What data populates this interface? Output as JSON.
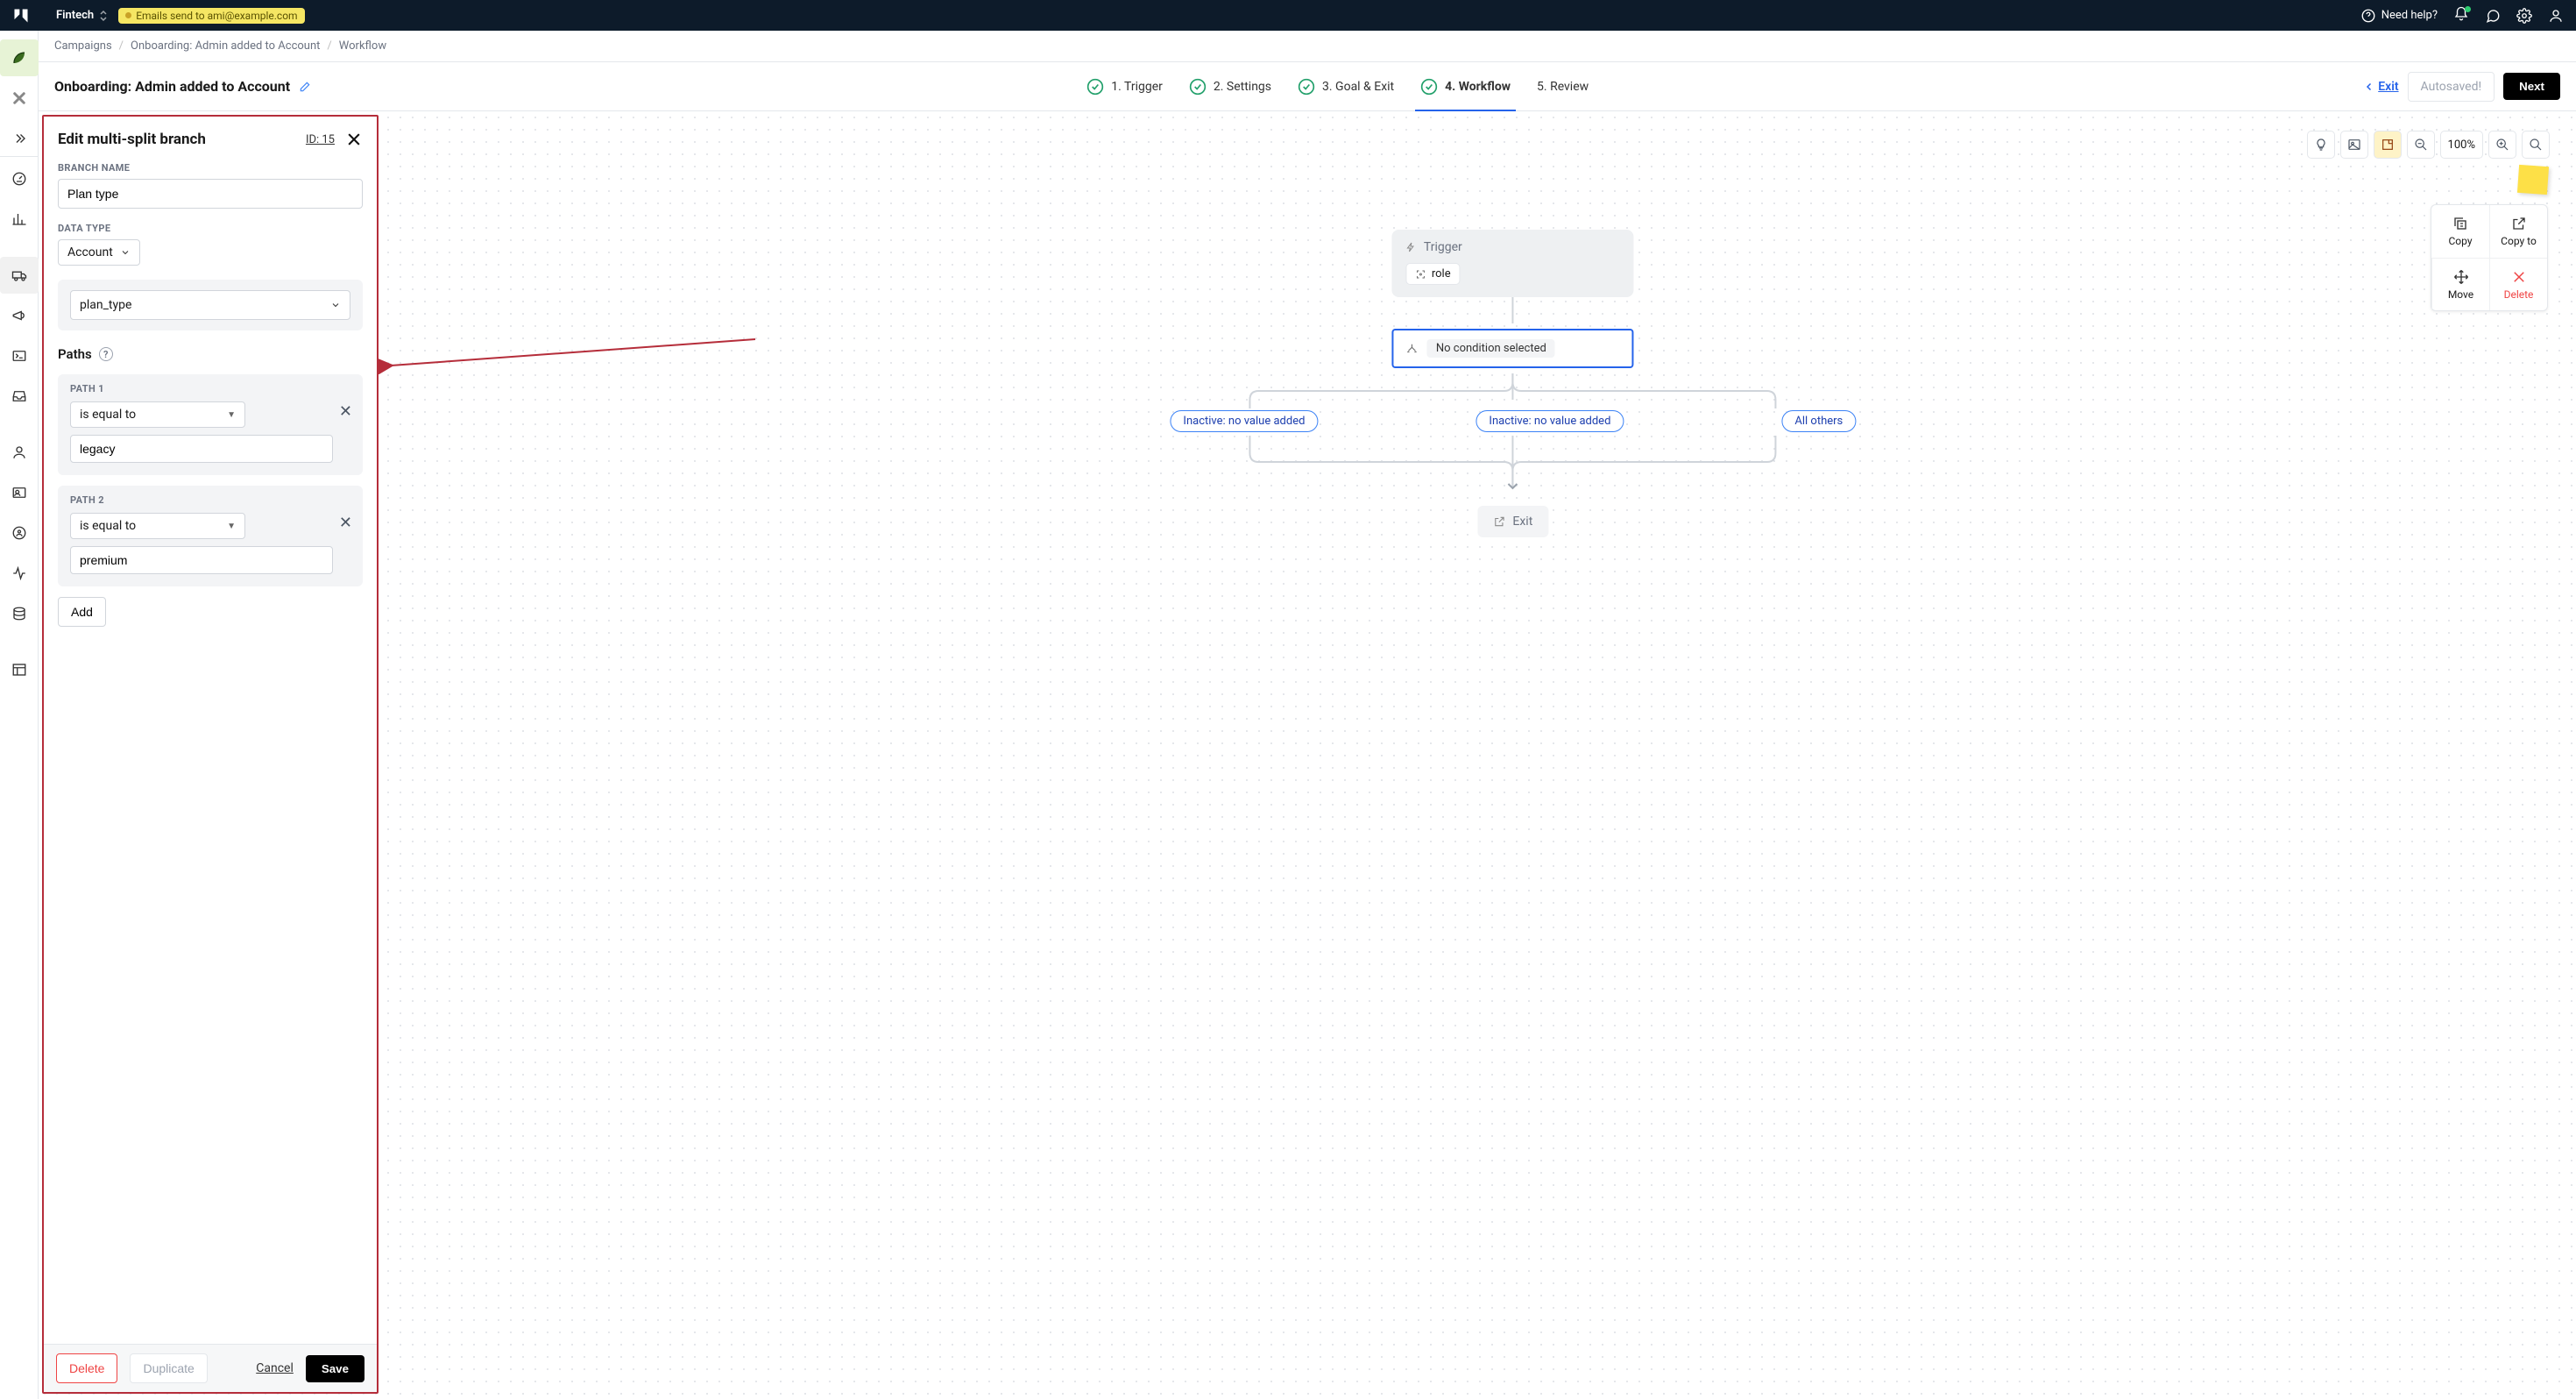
{
  "topbar": {
    "workspace": "Fintech",
    "tag": "Emails send to ami@example.com",
    "need_help": "Need help?"
  },
  "breadcrumbs": {
    "c1": "Campaigns",
    "c2": "Onboarding: Admin added to Account",
    "c3": "Workflow"
  },
  "header": {
    "title": "Onboarding: Admin added to Account",
    "exit": "Exit",
    "autosaved": "Autosaved!",
    "next": "Next"
  },
  "steps": {
    "s1": "1. Trigger",
    "s2": "2. Settings",
    "s3": "3. Goal & Exit",
    "s4": "4. Workflow",
    "s5": "5. Review"
  },
  "panel": {
    "title": "Edit multi-split branch",
    "id": "ID: 15",
    "branch_name_label": "BRANCH NAME",
    "branch_name_value": "Plan type",
    "data_type_label": "DATA TYPE",
    "data_type_value": "Account",
    "attribute_value": "plan_type",
    "paths_label": "Paths",
    "path1_label": "PATH 1",
    "path1_condition": "is equal to",
    "path1_value": "legacy",
    "path2_label": "PATH 2",
    "path2_condition": "is equal to",
    "path2_value": "premium",
    "add": "Add",
    "delete": "Delete",
    "duplicate": "Duplicate",
    "cancel": "Cancel",
    "save": "Save"
  },
  "toolbar": {
    "zoom": "100%"
  },
  "node_actions": {
    "copy": "Copy",
    "copy_to": "Copy to",
    "move": "Move",
    "delete": "Delete"
  },
  "flow": {
    "trigger": "Trigger",
    "role": "role",
    "condition": "No condition selected",
    "inactive1": "Inactive: no value added",
    "inactive2": "Inactive: no value added",
    "allothers": "All others",
    "exit": "Exit"
  }
}
